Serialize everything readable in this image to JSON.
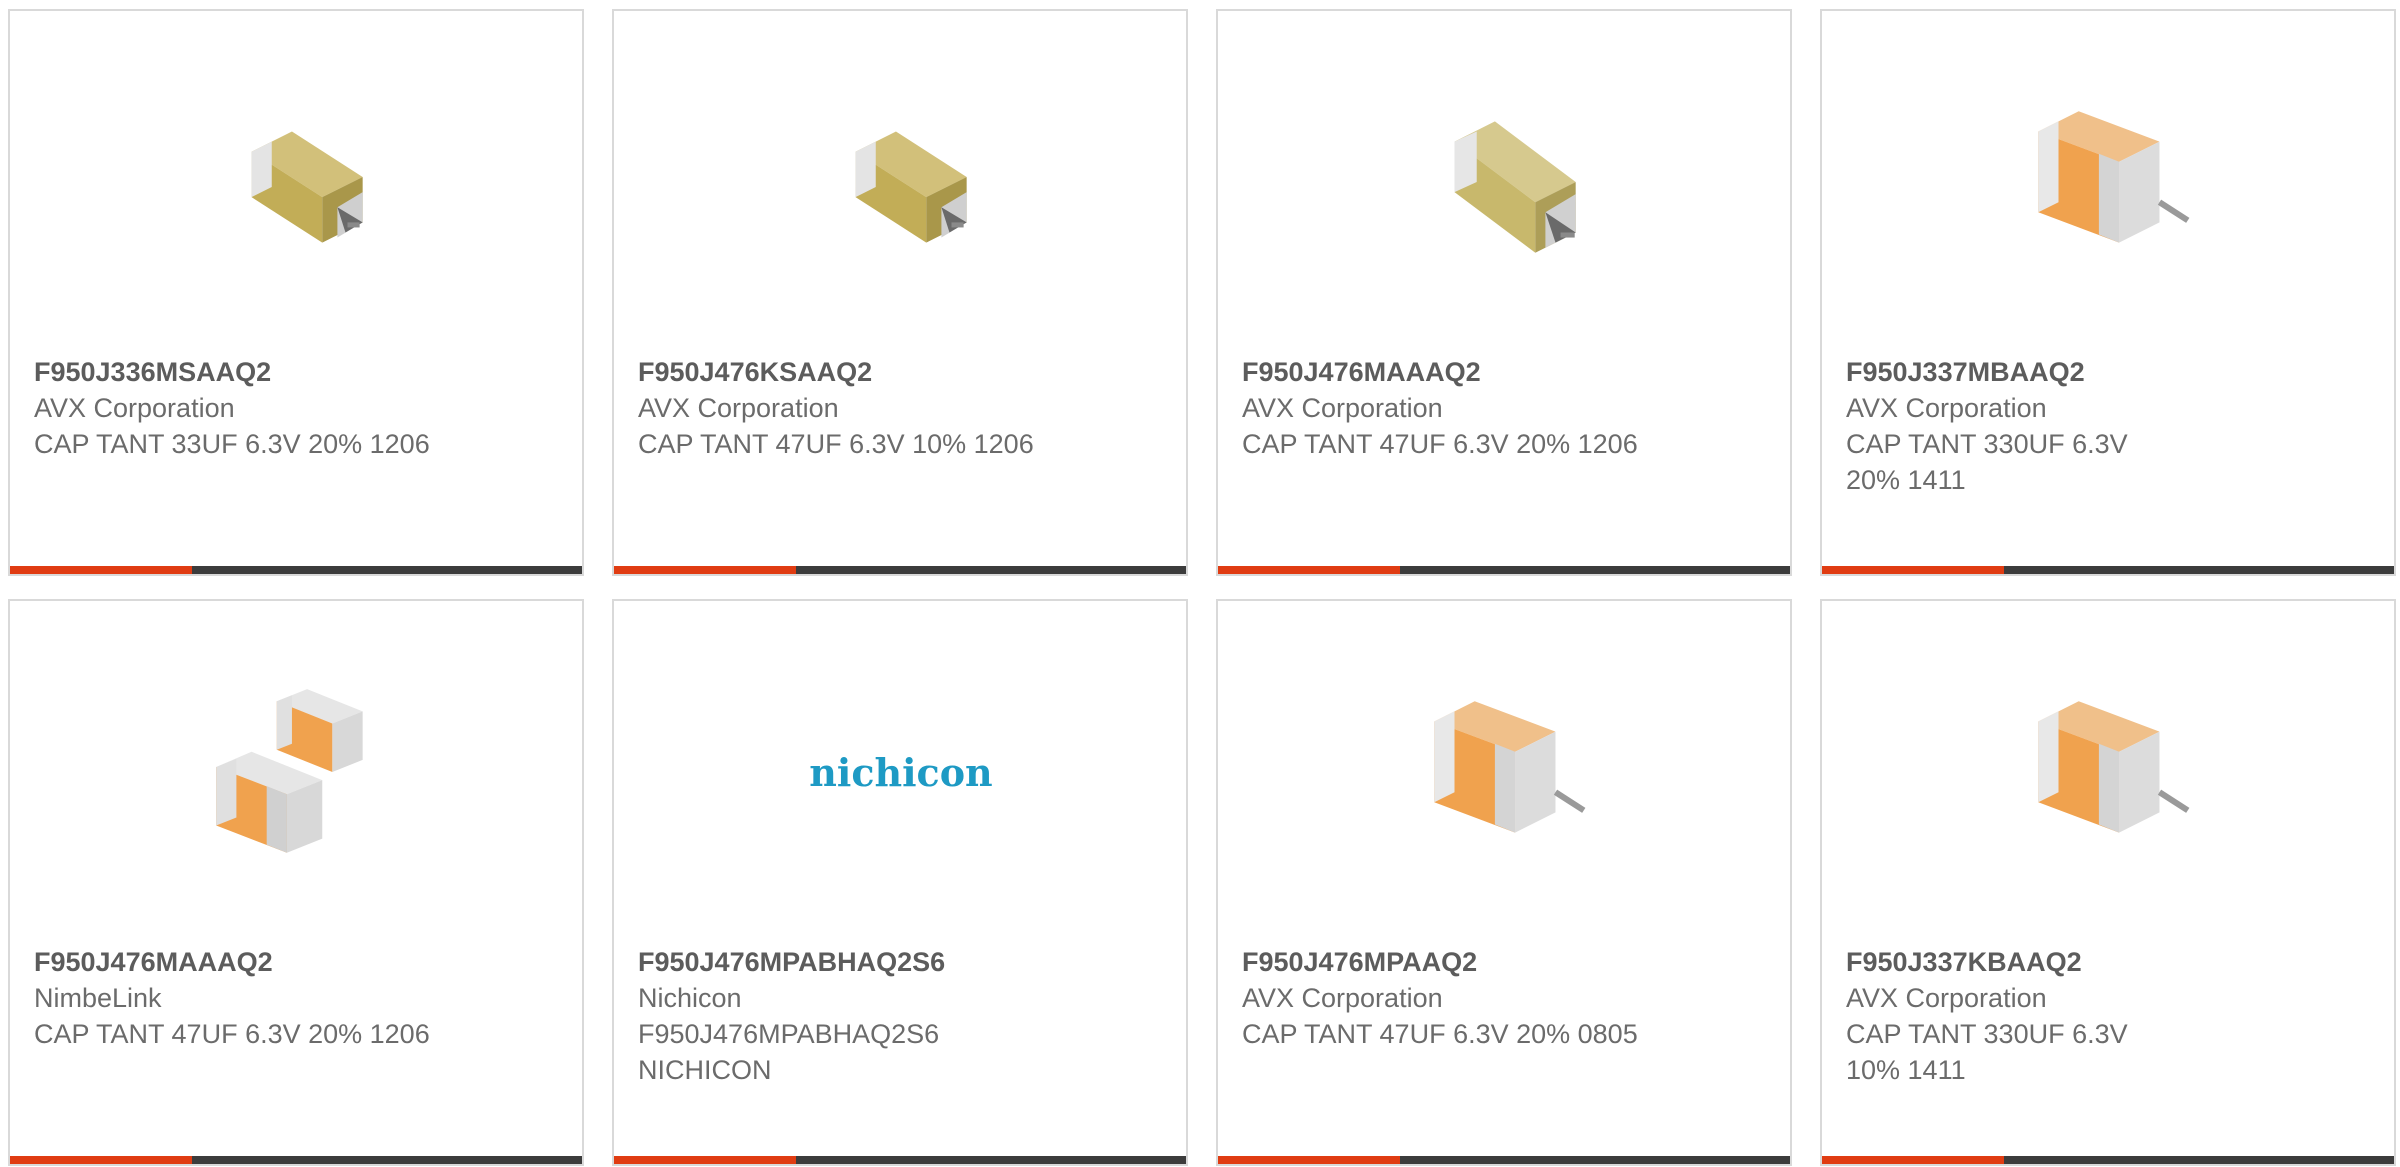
{
  "products": [
    {
      "part_number": "F950J336MSAAQ2",
      "manufacturer": "AVX Corporation",
      "description": "CAP TANT 33UF 6.3V 20% 1206",
      "image_icon": "tantalum-capacitor-tan-icon"
    },
    {
      "part_number": "F950J476KSAAQ2",
      "manufacturer": "AVX Corporation",
      "description": "CAP TANT 47UF 6.3V 10% 1206",
      "image_icon": "tantalum-capacitor-tan-icon"
    },
    {
      "part_number": "F950J476MAAAQ2",
      "manufacturer": "AVX Corporation",
      "description": "CAP TANT 47UF 6.3V 20% 1206",
      "image_icon": "tantalum-capacitor-tan-icon"
    },
    {
      "part_number": "F950J337MBAAQ2",
      "manufacturer": "AVX Corporation",
      "description": "CAP TANT 330UF 6.3V 20% 1411",
      "image_icon": "tantalum-capacitor-orange-icon"
    },
    {
      "part_number": "F950J476MAAAQ2",
      "manufacturer": "NimbeLink",
      "description": "CAP TANT 47UF 6.3V 20% 1206",
      "image_icon": "two-capacitors-icon"
    },
    {
      "part_number": "F950J476MPABHAQ2S6",
      "manufacturer": "Nichicon",
      "description": "F950J476MPABHAQ2S6 NICHICON",
      "image_icon": "nichicon-logo",
      "logo_text": "nichicon"
    },
    {
      "part_number": "F950J476MPAAQ2",
      "manufacturer": "AVX Corporation",
      "description": "CAP TANT 47UF 6.3V 20% 0805",
      "image_icon": "tantalum-capacitor-orange-icon"
    },
    {
      "part_number": "F950J337KBAAQ2",
      "manufacturer": "AVX Corporation",
      "description": "CAP TANT 330UF 6.3V 10% 1411",
      "image_icon": "tantalum-capacitor-orange-icon"
    }
  ],
  "colors": {
    "accent": "#e03c12",
    "bar": "#3c3c3c",
    "border": "#d9d9d9",
    "text": "#6b6b6b",
    "nichicon_blue": "#1e9ac4"
  }
}
